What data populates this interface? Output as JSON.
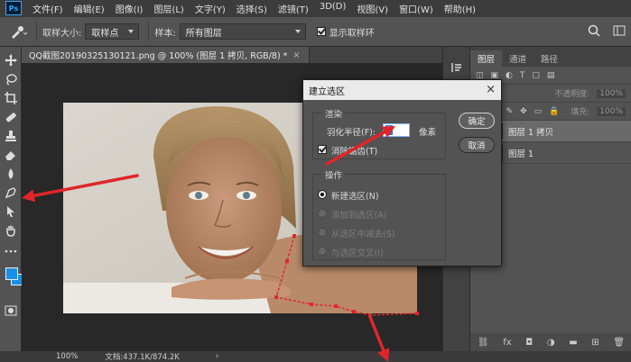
{
  "menubar": {
    "logo": "Ps",
    "items": [
      "文件(F)",
      "编辑(E)",
      "图像(I)",
      "图层(L)",
      "文字(Y)",
      "选择(S)",
      "滤镜(T)",
      "3D(D)",
      "视图(V)",
      "窗口(W)",
      "帮助(H)"
    ]
  },
  "options": {
    "sample_size_label": "取样大小:",
    "sample_size_value": "取样点",
    "sample_label": "样本:",
    "sample_value": "所有图层",
    "show_ring_label": "显示取样环"
  },
  "document": {
    "tab_title": "QQ截图20190325130121.png @ 100% (图层 1 拷贝, RGB/8) *",
    "tab_close": "×"
  },
  "status": {
    "zoom": "100%",
    "doc_info": "文档:437.1K/874.2K",
    "arrow": "›"
  },
  "layers_panel": {
    "tabs": [
      "图层",
      "通道",
      "路径"
    ],
    "opacity_label": "不透明度:",
    "opacity_value": "100%",
    "fill_label": "填充:",
    "fill_value": "100%",
    "layers": [
      {
        "name": "图层 1 拷贝",
        "selected": true
      },
      {
        "name": "图层 1",
        "selected": false
      }
    ]
  },
  "dialog": {
    "title": "建立选区",
    "close": "×",
    "render_group": "渲染",
    "feather_label": "羽化半径(F):",
    "feather_value": "2",
    "feather_unit": "像素",
    "antialias_label": "消除锯齿(T)",
    "operation_group": "操作",
    "operations": [
      {
        "label": "新建选区(N)",
        "checked": true,
        "disabled": false
      },
      {
        "label": "添加到选区(A)",
        "checked": false,
        "disabled": true
      },
      {
        "label": "从选区中减去(S)",
        "checked": false,
        "disabled": true
      },
      {
        "label": "与选区交叉(I)",
        "checked": false,
        "disabled": true
      }
    ],
    "ok": "确定",
    "cancel": "取消"
  },
  "colors": {
    "foreground": "#1a8fe6",
    "background": "#1a8fe6",
    "accent": "#31a8ff",
    "annotation": "#e0262a",
    "path_points": "#e0262a"
  },
  "icons": {
    "tool_icons": [
      "move-icon",
      "marquee-icon",
      "lasso-icon",
      "quick-select-icon",
      "crop-icon",
      "eyedropper-icon",
      "healing-icon",
      "brush-icon",
      "stamp-icon",
      "history-brush-icon",
      "eraser-icon",
      "gradient-icon",
      "blur-icon",
      "dodge-icon",
      "pen-icon",
      "type-icon",
      "path-select-icon",
      "rectangle-icon",
      "hand-icon",
      "zoom-icon",
      "more-icon"
    ]
  }
}
